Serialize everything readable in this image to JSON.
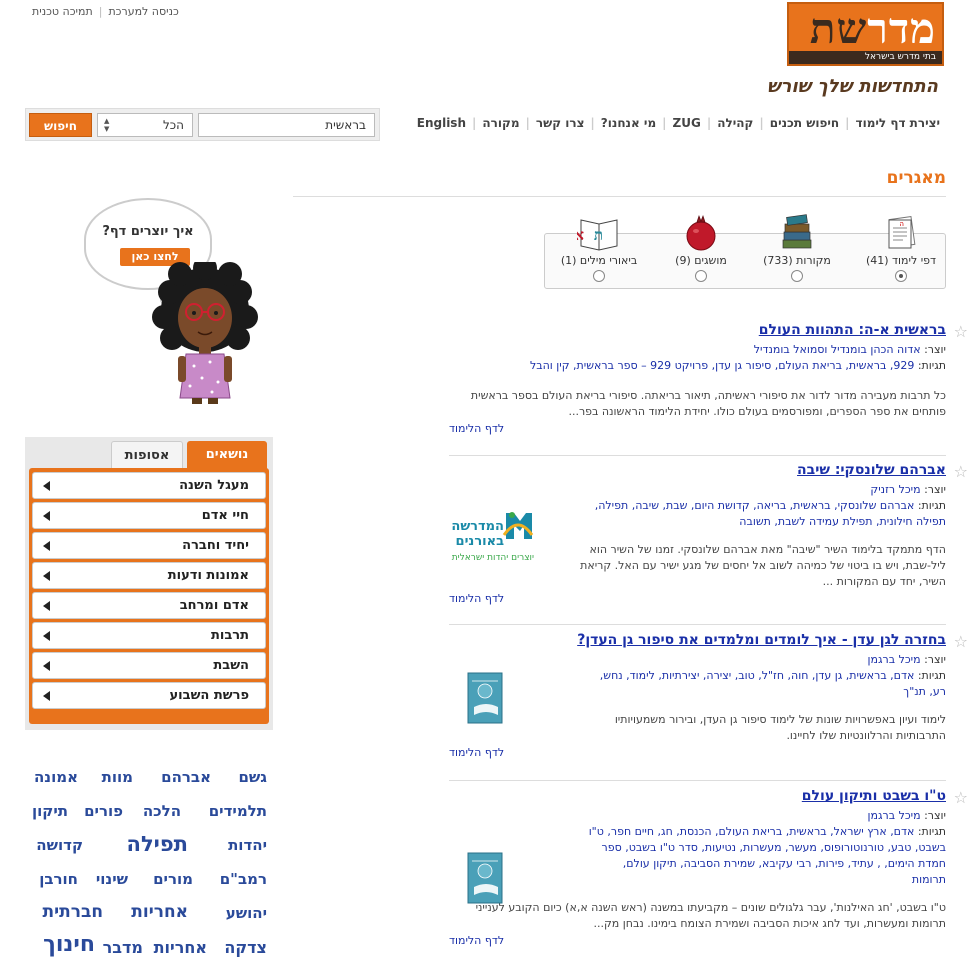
{
  "system_links": [
    "כניסה למערכת",
    "תמיכה טכנית"
  ],
  "logo": {
    "title_part1": "מדר",
    "title_part2": "שת",
    "subtitle": "בתי מדרש בישראל"
  },
  "tagline": "התחדשות שלך שורש",
  "nav": [
    "יצירת דף לימוד",
    "חיפוש תכנים",
    "קהילה",
    "ZUG",
    "מי אנחנו?",
    "צרו קשר",
    "מקורה",
    "English"
  ],
  "search": {
    "query": "בראשית",
    "scope": "הכל",
    "button": "חיפוש"
  },
  "section_title": "מאגרים",
  "repositories": [
    {
      "label": "דפי לימוד (41)",
      "icon": "study-page-icon",
      "selected": true
    },
    {
      "label": "מקורות (733)",
      "icon": "books-icon",
      "selected": false
    },
    {
      "label": "מושגים (9)",
      "icon": "pomegranate-icon",
      "selected": false
    },
    {
      "label": "ביאורי מילים (1)",
      "icon": "alef-book-icon",
      "selected": false
    }
  ],
  "bubble": {
    "question": "איך יוצרים דף?",
    "button": "לחצו כאן"
  },
  "category_tabs": {
    "active": "נושאים",
    "other": "אסופות"
  },
  "categories": [
    "מעגל השנה",
    "חיי אדם",
    "יחיד וחברה",
    "אמונות ודעות",
    "אדם ומרחב",
    "תרבות",
    "השבת",
    "פרשת השבוע"
  ],
  "tag_cloud": [
    "גשם",
    "אברהם",
    "מוות",
    "אמונה",
    "תלמידים",
    "הלכה",
    "פורים",
    "תיקון",
    "יהדות",
    "תפילה",
    "קדושה",
    "רמב\"ם",
    "מורים",
    "שינוי",
    "חורבן",
    "יהושע",
    "אחריות",
    "חברתית",
    "צדקה",
    "אחריות",
    "מדבר",
    "חינוך"
  ],
  "labels": {
    "creator": "יוצר:",
    "tags": "תגיות:",
    "to_page": "לדף הלימוד"
  },
  "results": [
    {
      "title": "בראשית א-ה: התהוות העולם",
      "creator": "אדוה הכהן בומנדיל וסמואל בומנדיל",
      "tags_lines": [
        "929, בראשית, בריאת העולם, סיפור גן עדן, פרויקט 929 – ספר בראשית, קין והבל"
      ],
      "desc": "כל תרבות מעבירה מדור לדור את סיפורי ראשיתה, תיאור בריאתה. סיפורי בריאת העולם בספר בראשית פותחים את ספר הספרים, ומפורסמים בעולם כולו. יחידת הלימוד הראשונה בפר..."
    },
    {
      "title": "אברהם שלונסקי: שיבה",
      "creator": "מיכל רזניק",
      "tags_lines": [
        "אברהם שלונסקי, בראשית, בריאה, קדושת היום, שבת, שיבה, תפילה,",
        "תפילה חילונית, תפילת עמידה לשבת, תשובה"
      ],
      "desc": "הדף מתמקד בלימוד השיר \"שיבה\" מאת אברהם שלונסקי. זמנו של השיר הוא ליל-שבת, ויש בו ביטוי של כמיהה לשוב אל יחסים של מגע ישיר עם האל. קריאת השיר, יחד עם המקורות ...",
      "thumb_text": {
        "line1": "המדרשה",
        "line2": "באורנים",
        "line3": "יוצרים יהדות ישראלית"
      }
    },
    {
      "title": "בחזרה לגן עדן - איך לומדים ומלמדים את סיפור גן העדן?",
      "creator": "מיכל ברגמן",
      "tags_lines": [
        "אדם, בראשית, גן עדן, חוה, חז\"ל, טוב, יצירה, יצירתיות, לימוד, נחש,",
        "רע, תנ\"ך"
      ],
      "desc": "לימוד ועיון באפשרויות שונות של לימוד סיפור גן העדן, ובירור משמעויותיו התרבותיות והרלוונטיות שלו לחיינו."
    },
    {
      "title": "ט\"ו בשבט ותיקון עולם",
      "creator": "מיכל ברגמן",
      "tags_lines": [
        "אדם, ארץ ישראל, בראשית, בריאת העולם, הכנסת, חג, חיים חפר, ט\"ו",
        "בשבט, טבע, טורנוטורופוס, מעשר, מעשרות, נטיעות, סדר ט\"ו בשבט, ספר",
        "חמדת הימים, , עתיד, פירות, רבי עקיבא, שמירת הסביבה, תיקון עולם,",
        "תרומות"
      ],
      "desc": "ט\"ו בשבט, 'חג האילנות', עבר גלגולים שונים – מקביעתו במשנה (ראש השנה א,א) כיום הקובע לענייני תרומות ומעשרות, ועד לחג איכות הסביבה ושמירת הצומח בימינו. נבחן מק..."
    }
  ]
}
